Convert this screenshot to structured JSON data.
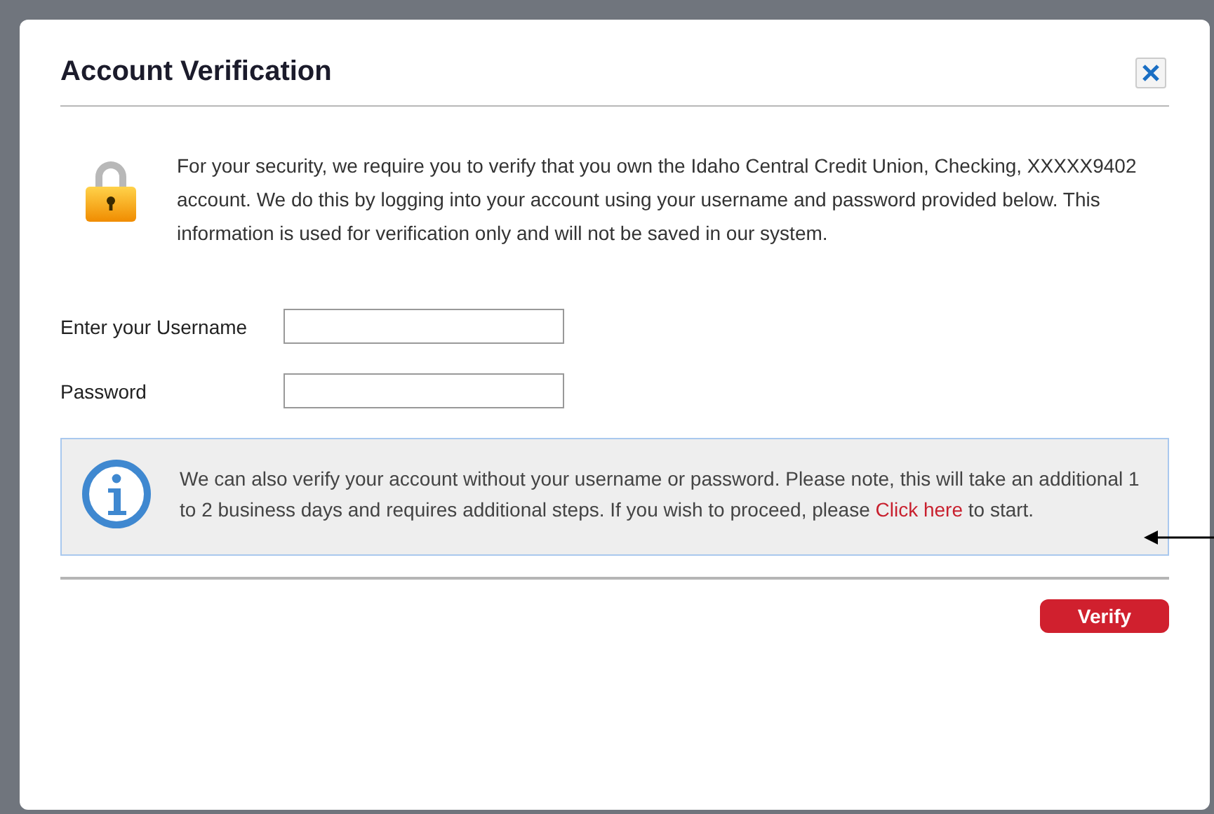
{
  "dialog": {
    "title": "Account Verification"
  },
  "notice": "For your security, we require you to verify that you own the Idaho Central Credit Union, Checking, XXXXX9402 account. We do this by logging into your account using your username and password provided below. This information is used for verification only and will not be saved in our system.",
  "fields": [
    {
      "label": "Enter your Username"
    },
    {
      "label": "Password"
    }
  ],
  "info": {
    "text": "We can also verify your account without your username or password. Please note, this will take an additional 1 to 2 business days and requires additional steps. If you wish to proceed, please",
    "link": "Click here",
    "text_after": "to start."
  },
  "buttons": [
    "Verify"
  ]
}
